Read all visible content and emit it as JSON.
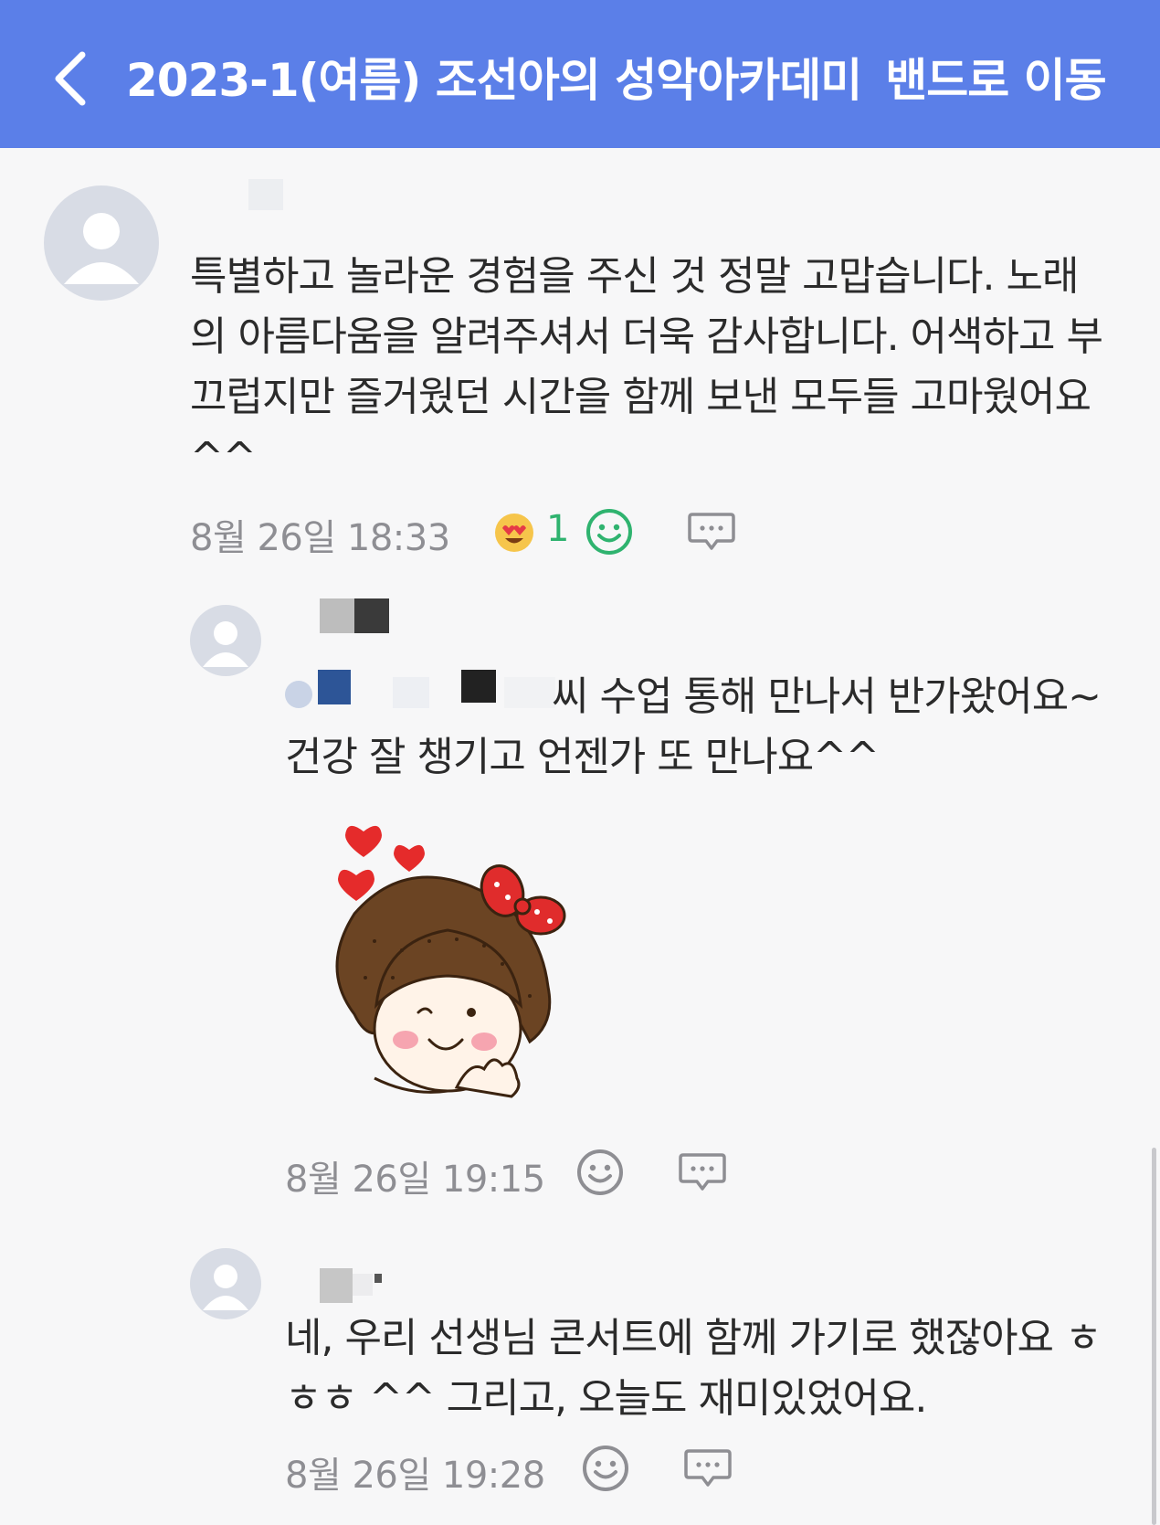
{
  "header": {
    "title": "2023-1(여름) 조선아의 성악아카데미",
    "action": "밴드로 이동",
    "back_icon": "chevron-left-icon",
    "background": "#5b7fe8"
  },
  "comments": [
    {
      "text": "특별하고 놀라운 경험을 주신 것 정말 고맙습니다. 노래의 아름다움을 알려주셔서 더욱 감사합니다. 어색하고 부끄럽지만 즐거웠던 시간을 함께 보낸 모두들 고마웠어요^^",
      "timestamp": "8월 26일 18:33",
      "reaction_icon": "heart-eyes-emoji-icon",
      "reaction_count": "1"
    },
    {
      "text_suffix": "씨 수업 통해 만나서 반가왔어요~건강 잘 챙기고 언젠가 또 만나요^^",
      "timestamp": "8월 26일 19:15",
      "sticker": "girl-with-hearts-sticker"
    },
    {
      "text": "네, 우리 선생님 콘서트에 함께 가기로 했잖아요 ㅎㅎㅎ ^^ 그리고, 오늘도 재미있었어요.",
      "timestamp": "8월 26일 19:28"
    }
  ],
  "colors": {
    "accent": "#5b7fe8",
    "reaction_green": "#2fb36f",
    "timestamp_gray": "#8e8e93"
  }
}
